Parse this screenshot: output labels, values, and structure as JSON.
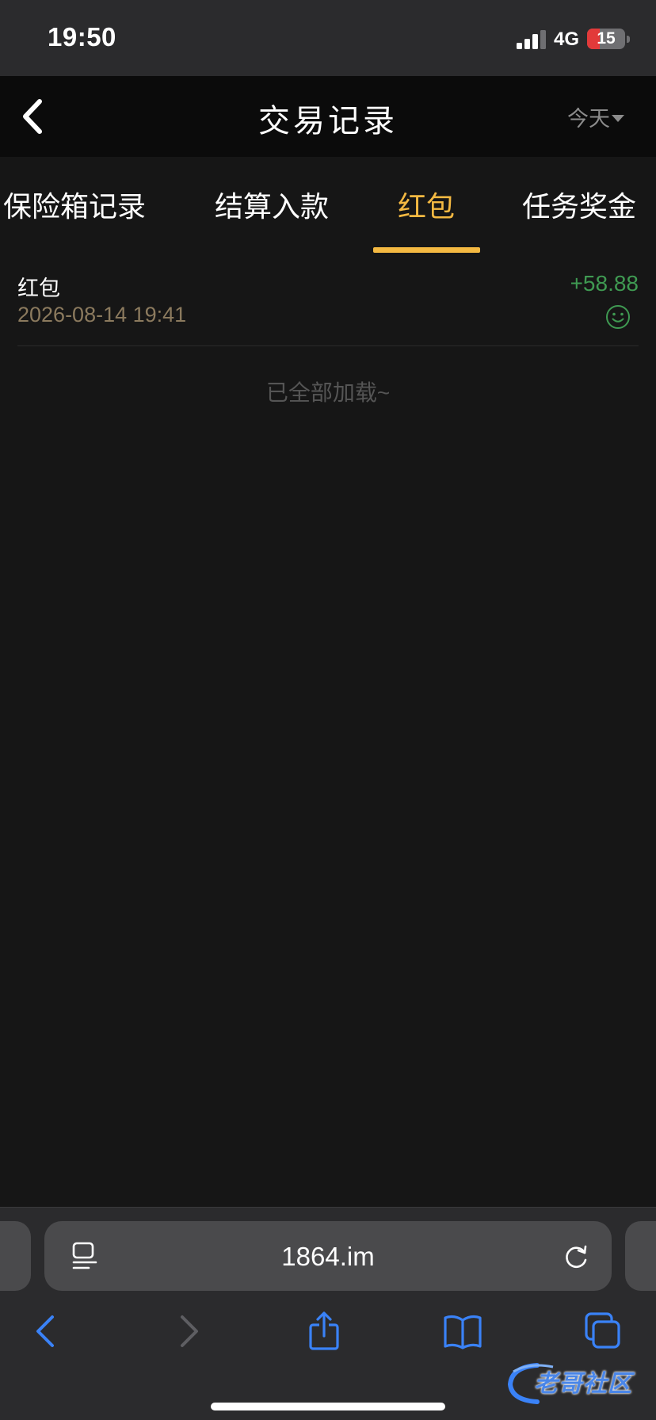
{
  "status_bar": {
    "time": "19:50",
    "network": "4G",
    "battery": "15",
    "battery_level": 0.15,
    "battery_color": "#e23a3a"
  },
  "header": {
    "back_icon": "chevron-left-icon",
    "title": "交易记录",
    "date_filter": "今天",
    "filter_icon": "caret-down-icon"
  },
  "tabs": [
    {
      "label": "保险箱记录",
      "active": false
    },
    {
      "label": "结算入款",
      "active": false
    },
    {
      "label": "红包",
      "active": true
    },
    {
      "label": "任务奖金",
      "active": false
    }
  ],
  "accent_color": "#f4b942",
  "records": [
    {
      "title": "红包",
      "time": "2026-08-14 19:41",
      "amount": "+58.88",
      "icon": "smile-icon",
      "amount_color": "#3f9a52"
    }
  ],
  "list_footer": "已全部加载~",
  "browser": {
    "url": "1864.im",
    "icons": [
      "reader-icon",
      "reload-icon",
      "back-icon",
      "forward-icon",
      "share-icon",
      "bookmarks-icon",
      "tabs-icon"
    ],
    "tint_color": "#3a82f7"
  },
  "watermark": {
    "text": "老哥社区"
  }
}
